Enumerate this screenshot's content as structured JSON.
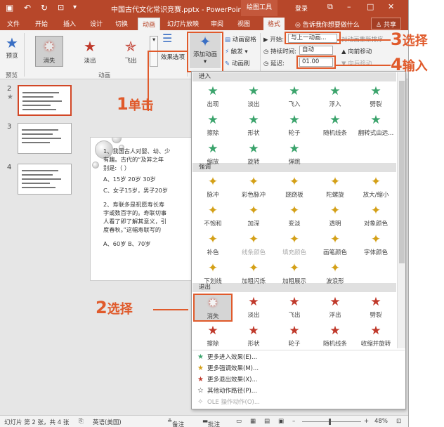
{
  "titlebar": {
    "save_icon": "save-icon",
    "undo_icon": "undo-icon",
    "redo_icon": "redo-icon",
    "document_title": "中国古代文化常识竞赛.pptx - PowerPoint",
    "tools_label": "绘图工具",
    "login_label": "登录",
    "restore_icon": "restore-icon",
    "minimize_icon": "minimize-icon",
    "maximize_icon": "maximize-icon",
    "close_icon": "close-icon"
  },
  "tabs": [
    {
      "label": "文件"
    },
    {
      "label": "开始"
    },
    {
      "label": "插入"
    },
    {
      "label": "设计"
    },
    {
      "label": "切换"
    },
    {
      "label": "动画"
    },
    {
      "label": "幻灯片放映"
    },
    {
      "label": "审阅"
    },
    {
      "label": "视图"
    },
    {
      "label": "格式"
    }
  ],
  "tellme": "告诉我你想要做什么",
  "share": "共享",
  "ribbon": {
    "preview_label": "预览",
    "preview_group": "预览",
    "effects": [
      {
        "label": "消失"
      },
      {
        "label": "淡出"
      },
      {
        "label": "飞出"
      }
    ],
    "animation_group": "动画",
    "effect_options": "效果选项",
    "add_animation": "添加动画",
    "animation_pane": "动画窗格",
    "trigger": "触发",
    "animation_painter": "动画刷",
    "start_label": "开始:",
    "start_value": "与上一动画...",
    "duration_label": "持续时间:",
    "duration_value": "自动",
    "delay_label": "延迟:",
    "delay_value": "01.00",
    "reorder_label": "对动画重新排序",
    "move_earlier": "向前移动",
    "move_later": "向后移动"
  },
  "slides": [
    {
      "num": "2",
      "star": "★"
    },
    {
      "num": "3"
    },
    {
      "num": "4"
    }
  ],
  "slide_text": [
    "1、我国古人对婴、幼、少",
    "有趣。古代的“及笄之年",
    "别是:（ ）",
    "A、15岁 20岁 30岁",
    "C、女子15岁，男子20岁",
    "2、寿联多是祝愿寿长寿",
    "字或数百字的。寿联切事",
    "人看了即了解其意义，引",
    "度春秋。”这幅寿联写的",
    "A、60岁    B、70岁"
  ],
  "gallery": {
    "entrance_header": "进入",
    "entrance": [
      "出现",
      "淡出",
      "飞入",
      "浮入",
      "劈裂",
      "擦除",
      "形状",
      "轮子",
      "随机线条",
      "翻转式由远...",
      "缩放",
      "旋转",
      "弹跳"
    ],
    "emphasis_header": "强调",
    "emphasis": [
      "脉冲",
      "彩色脉冲",
      "跷跷板",
      "陀螺旋",
      "放大/缩小",
      "不饱和",
      "加深",
      "变淡",
      "透明",
      "对象颜色",
      "补色",
      "线条颜色",
      "填充颜色",
      "画笔颜色",
      "字体颜色",
      "下划线",
      "加粗闪烁",
      "加粗展示",
      "波浪形"
    ],
    "exit_header": "退出",
    "exit": [
      "消失",
      "淡出",
      "飞出",
      "浮出",
      "劈裂",
      "擦除",
      "形状",
      "轮子",
      "随机线条",
      "收缩并旋转"
    ],
    "menu": [
      "更多进入效果(E)...",
      "更多强调效果(M)...",
      "更多退出效果(X)...",
      "其他动作路径(P)...",
      "OLE 操作动作(O)..."
    ]
  },
  "statusbar": {
    "slide_info": "幻灯片 第 2 张，共 4 张",
    "language": "英语(美国)",
    "notes": "备注",
    "comments": "批注",
    "zoom": "48%"
  },
  "callouts": [
    {
      "num": "1",
      "text": "单击"
    },
    {
      "num": "2",
      "text": "选择"
    },
    {
      "num": "3",
      "text": "选择"
    },
    {
      "num": "4",
      "text": "输入"
    }
  ],
  "colors": {
    "accent": "#b7472a",
    "callout": "#e05a2b"
  }
}
